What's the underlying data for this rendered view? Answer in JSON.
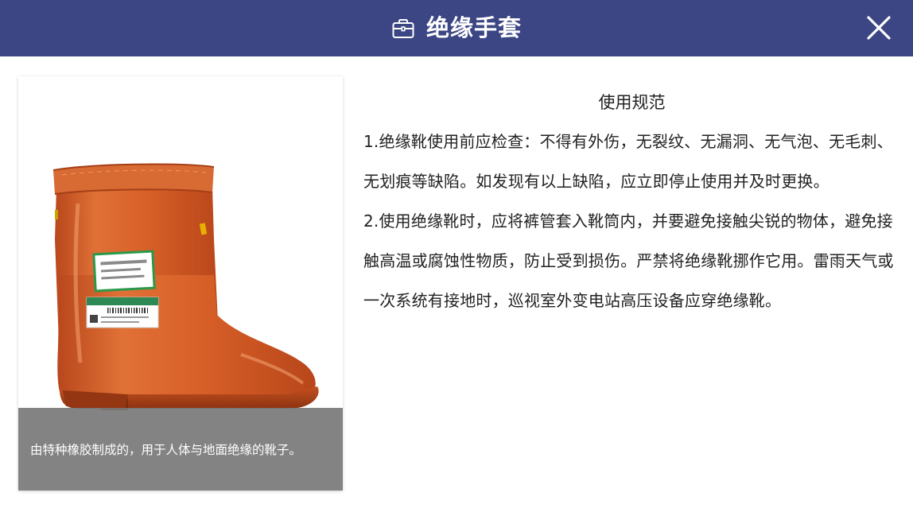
{
  "header": {
    "title": "绝缘手套",
    "title_icon": "toolbox-icon",
    "close_icon": "close-icon",
    "background": "#3c4684"
  },
  "card": {
    "image": "rubber-insulating-boot",
    "caption": "由特种橡胶制成的，用于人体与地面绝缘的靴子。"
  },
  "guide": {
    "heading": "使用规范",
    "paragraphs": [
      "1.绝缘靴使用前应检查：不得有外伤，无裂纹、无漏洞、无气泡、无毛刺、无划痕等缺陷。如发现有以上缺陷，应立即停止使用并及时更换。",
      "2.使用绝缘靴时，应将裤管套入靴筒内，并要避免接触尖锐的物体，避免接触高温或腐蚀性物质，防止受到损伤。严禁将绝缘靴挪作它用。雷雨天气或一次系统有接地时，巡视室外变电站高压设备应穿绝缘靴。"
    ]
  }
}
